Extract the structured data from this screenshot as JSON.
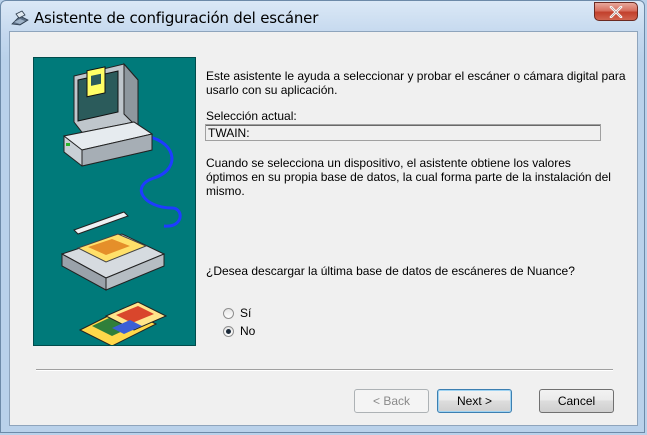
{
  "window": {
    "title": "Asistente de configuración del escáner",
    "close_label": "x"
  },
  "content": {
    "intro": "Este asistente le ayuda a seleccionar y probar el escáner o cámara digital para usarlo con su aplicación.",
    "selection_label": "Selección actual:",
    "selection_value": "TWAIN:",
    "info": "Cuando se selecciona un dispositivo, el asistente obtiene los valores óptimos en su propia base de datos, la cual forma parte de la instalación del mismo.",
    "question": "¿Desea descargar la última base de datos de escáneres de Nuance?",
    "options": [
      {
        "label": "Sí",
        "checked": false
      },
      {
        "label": "No",
        "checked": true
      }
    ]
  },
  "buttons": {
    "back": "< Back",
    "next": "Next >",
    "cancel": "Cancel"
  },
  "colors": {
    "art_background": "#007a7a",
    "window_frame": "#b9d1ea"
  }
}
